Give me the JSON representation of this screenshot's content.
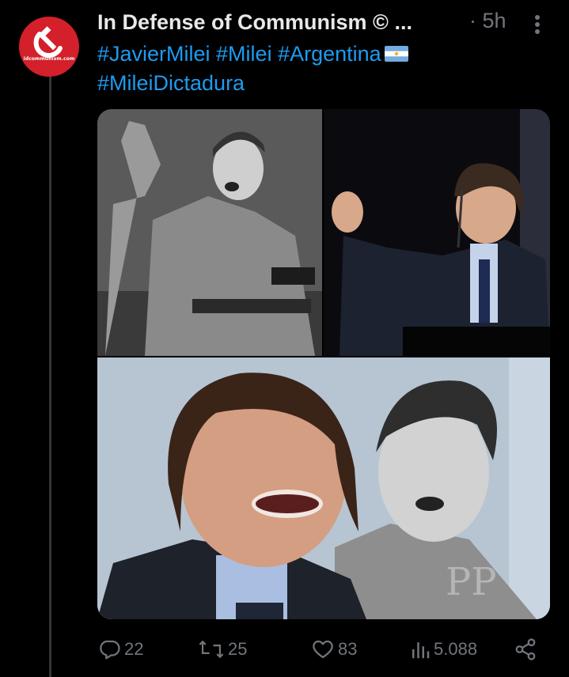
{
  "tweet": {
    "display_name": "In Defense of Communism © ...",
    "time": "· 5h",
    "hashtags_line1": "#JavierMilei #Milei #Argentina",
    "hashtags_line2": "#MileiDictadura",
    "avatar_text": "idcommunism.com",
    "watermark": "PP"
  },
  "actions": {
    "replies": "22",
    "reposts": "25",
    "likes": "83",
    "views": "5.088"
  },
  "icons": {
    "more": "more-dots-icon",
    "reply": "reply-icon",
    "repost": "repost-icon",
    "like": "heart-icon",
    "views": "views-icon",
    "share": "share-icon",
    "flag": "argentina-flag-icon"
  },
  "colors": {
    "background": "#000000",
    "text": "#e7e9ea",
    "muted": "#71767b",
    "link": "#1d9bf0",
    "avatar": "#d3202a"
  }
}
